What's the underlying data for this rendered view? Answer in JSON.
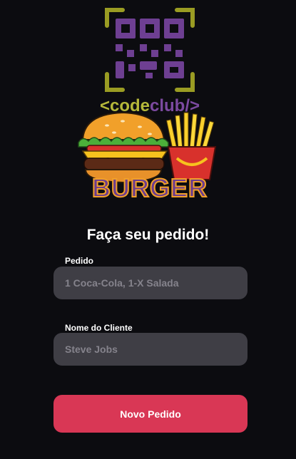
{
  "logo": {
    "brand_text_left": "<code",
    "brand_text_right": "club/>",
    "burger_word": "BURGER",
    "colors": {
      "qr_purple": "#6e3f92",
      "qr_frame": "#9a9c23",
      "code_text": "#b5b83a",
      "club_text": "#7c4aa0",
      "burger_word_fill": "#6b3b8f"
    }
  },
  "form": {
    "title": "Faça seu pedido!",
    "order": {
      "label": "Pedido",
      "placeholder": "1 Coca-Cola, 1-X Salada"
    },
    "client": {
      "label": "Nome do Cliente",
      "placeholder": "Steve Jobs"
    },
    "submit_label": "Novo Pedido"
  },
  "colors": {
    "background": "#0c0c10",
    "input_bg": "#3f3e45",
    "button": "#d93755"
  }
}
